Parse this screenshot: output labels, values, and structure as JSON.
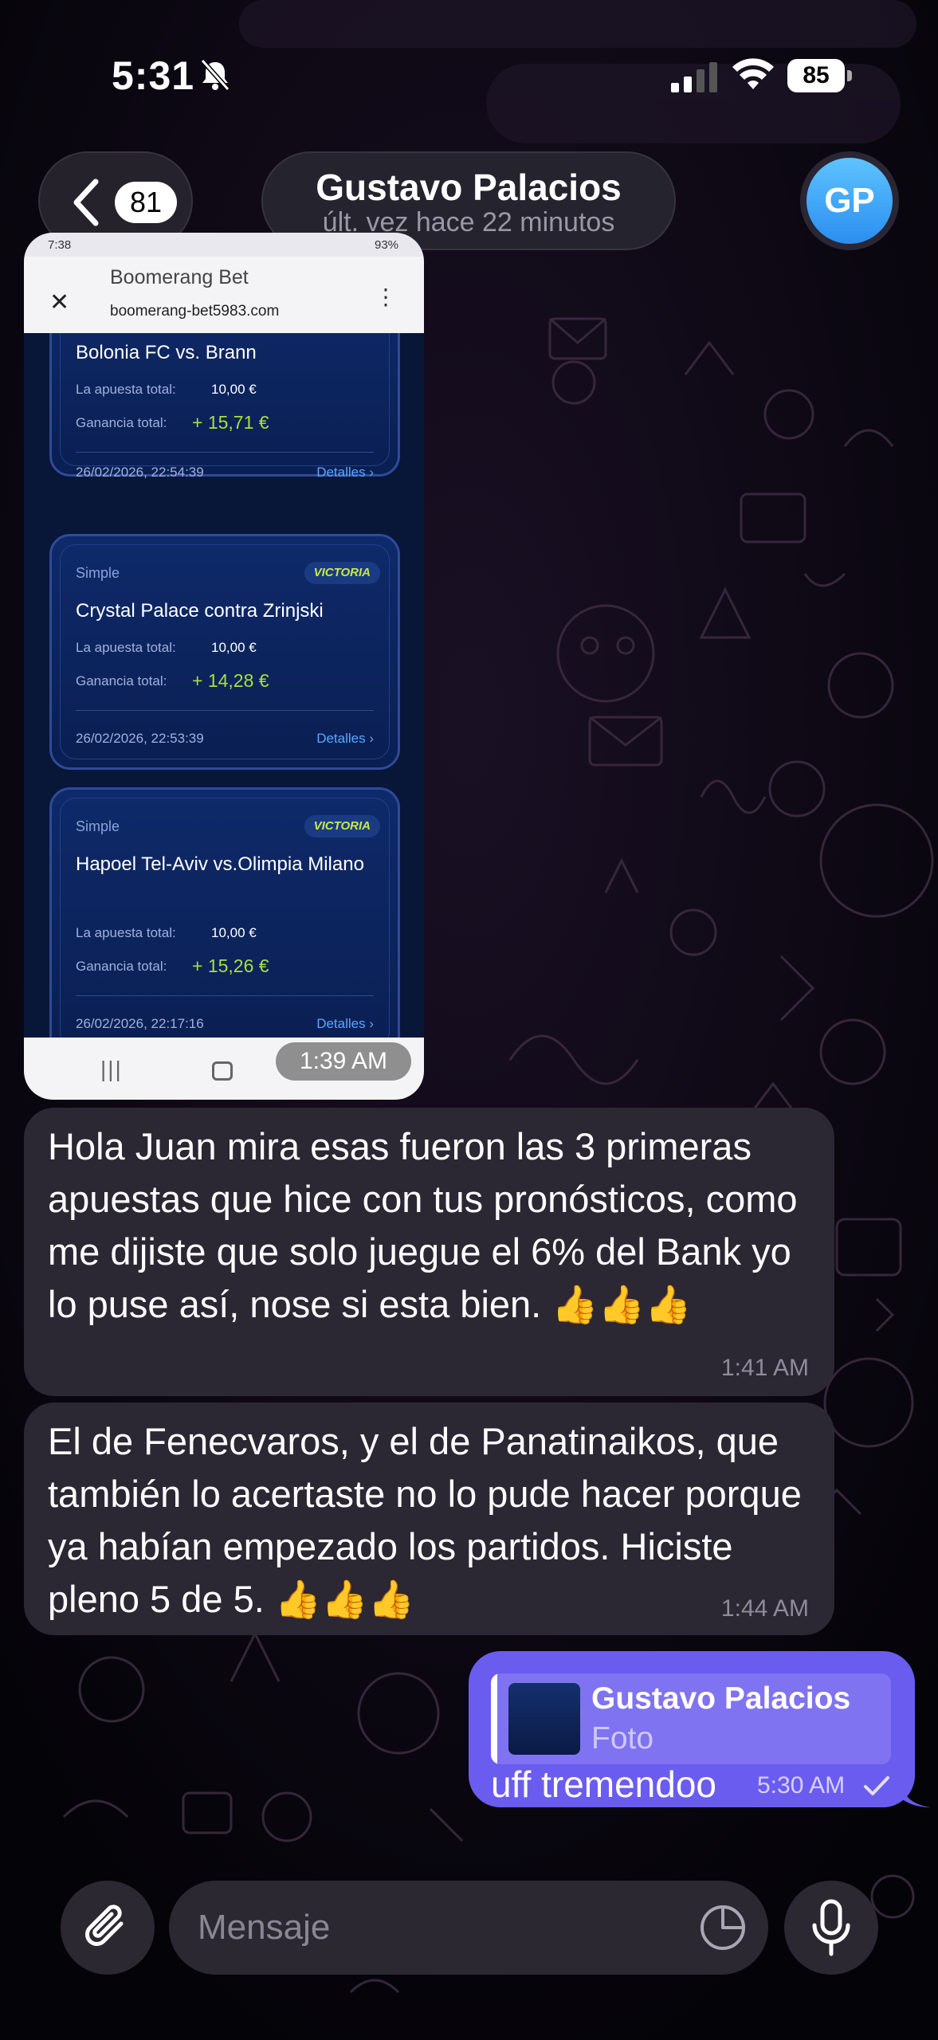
{
  "status_bar": {
    "time": "5:31",
    "battery": "85"
  },
  "header": {
    "back_count": "81",
    "contact_name": "Gustavo Palacios",
    "last_seen": "últ. vez hace 22 minutos",
    "avatar_initials": "GP"
  },
  "photo_message": {
    "time": "1:39 AM",
    "screenshot": {
      "status_time": "7:38",
      "status_battery": "93%",
      "site_title": "Boomerang Bet",
      "site_url": "boomerang-bet5983.com",
      "bets": [
        {
          "type": "",
          "badge": "",
          "match": "Bolonia FC vs. Brann",
          "stake_label": "La apuesta total:",
          "stake": "10,00 €",
          "gain_label": "Ganancia total:",
          "gain": "+ 15,71 €",
          "date": "26/02/2026, 22:54:39",
          "details": "Detalles ›"
        },
        {
          "type": "Simple",
          "badge": "VICTORIA",
          "match": "Crystal Palace contra Zrinjski",
          "stake_label": "La apuesta total:",
          "stake": "10,00 €",
          "gain_label": "Ganancia total:",
          "gain": "+ 14,28 €",
          "date": "26/02/2026, 22:53:39",
          "details": "Detalles ›"
        },
        {
          "type": "Simple",
          "badge": "VICTORIA",
          "match": "Hapoel Tel-Aviv vs.Olimpia Milano",
          "stake_label": "La apuesta total:",
          "stake": "10,00 €",
          "gain_label": "Ganancia total:",
          "gain": "+ 15,26 €",
          "date": "26/02/2026, 22:17:16",
          "details": "Detalles ›"
        }
      ]
    }
  },
  "messages": [
    {
      "text": "Hola Juan mira esas fueron las 3 primeras apuestas que hice con tus pronósticos, como me dijiste que solo juegue el 6%  del Bank yo lo puse así, nose si esta bien. 👍👍👍",
      "time": "1:41 AM"
    },
    {
      "text": "El de Fenecvaros, y el de Panatinaikos, que también lo acertaste no lo pude hacer porque ya habían empezado los partidos. Hiciste pleno 5 de 5. 👍👍👍",
      "time": "1:44 AM"
    }
  ],
  "outgoing": {
    "reply_name": "Gustavo Palacios",
    "reply_type": "Foto",
    "text": "uff tremendoo",
    "time": "5:30 AM"
  },
  "input": {
    "placeholder": "Mensaje"
  },
  "colors": {
    "outgoing_bubble": "#6b5cf0",
    "incoming_bubble": "#2b2733",
    "avatar": "#3aa6f5",
    "win_green": "#a8e03c"
  }
}
